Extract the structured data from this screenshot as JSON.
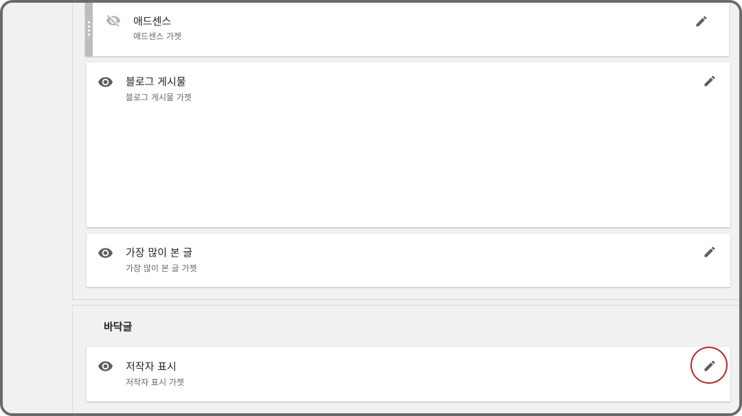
{
  "gadgets": [
    {
      "title": "애드센스",
      "subtitle": "애드센스 가젯",
      "visibility": "hidden"
    },
    {
      "title": "블로그 게시물",
      "subtitle": "블로그 게시물 가젯",
      "visibility": "visible"
    },
    {
      "title": "가장 많이 본 글",
      "subtitle": "가장 많이 본 글 가젯",
      "visibility": "visible"
    }
  ],
  "footer_section": {
    "heading": "바닥글",
    "gadget": {
      "title": "저작자 표시",
      "subtitle": "저작자 표시 가젯",
      "visibility": "visible"
    }
  },
  "colors": {
    "icon": "#5f5f5f",
    "highlight": "#b3262a",
    "hidden_icon": "#b5b5b5"
  }
}
